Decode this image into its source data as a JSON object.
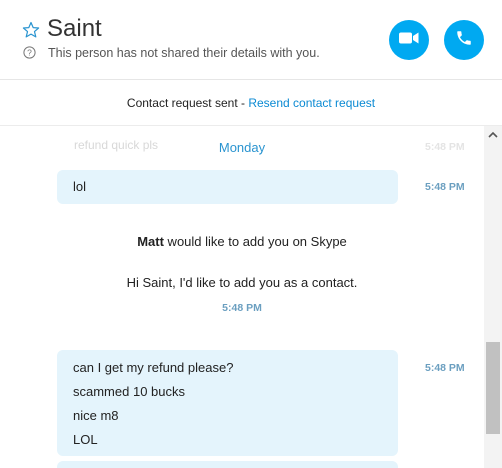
{
  "header": {
    "contact_name": "Saint",
    "status_text": "This person has not shared their details with you.",
    "icons": {
      "favorite": "star-icon",
      "info": "info-icon",
      "video": "video-camera-icon",
      "call": "phone-icon"
    },
    "accent_color": "#00a9f1"
  },
  "request_bar": {
    "text": "Contact request sent - ",
    "link": "Resend contact request"
  },
  "conversation": {
    "faded_message": "refund quick pls",
    "faded_time": "5:48 PM",
    "day_label": "Monday",
    "messages": [
      {
        "lines": [
          "lol"
        ],
        "time": "5:48 PM"
      },
      {
        "lines": [
          "can I get my refund please?",
          "scammed 10 bucks",
          "nice m8",
          "LOL"
        ],
        "time": "5:48 PM"
      }
    ],
    "system": {
      "sender": "Matt",
      "line1_rest": " would like to add you on Skype",
      "line2": "Hi Saint, I'd like to add you as a contact.",
      "time": "5:48 PM"
    }
  }
}
